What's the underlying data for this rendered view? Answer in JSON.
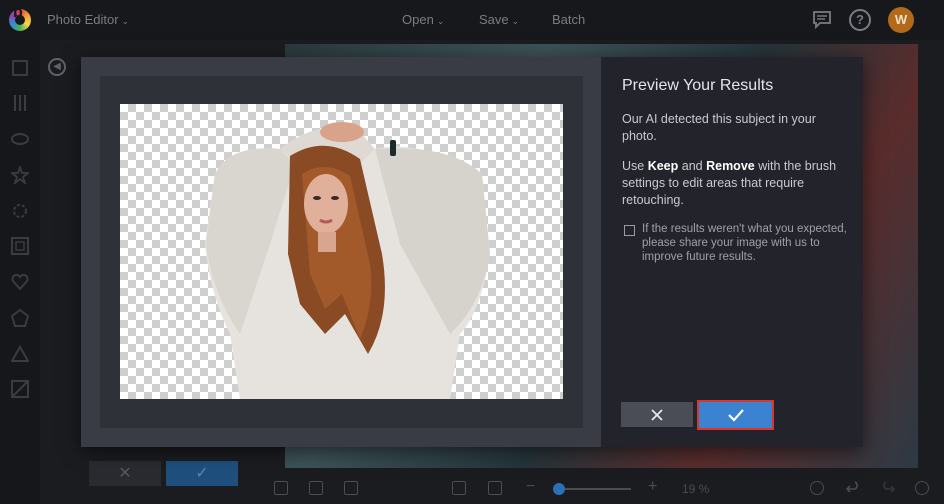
{
  "topbar": {
    "logo_letter": "b",
    "app_title": "Photo Editor",
    "menu": {
      "open": "Open",
      "save": "Save",
      "batch": "Batch"
    },
    "help_glyph": "?",
    "avatar_initial": "W"
  },
  "sidebar": {
    "icons": [
      "crop-icon",
      "adjust-icon",
      "eye-icon",
      "star-icon",
      "effects-icon",
      "frame-icon",
      "heart-icon",
      "shape-icon",
      "triangle-icon",
      "texture-icon"
    ]
  },
  "bottombar": {
    "zoom_minus": "−",
    "zoom_plus": "+",
    "zoom_value": "19 %",
    "zoom_fraction": 0.05
  },
  "modal": {
    "title": "Preview Your Results",
    "paragraph1": "Our AI detected this subject in your photo.",
    "paragraph2_parts": {
      "use": "Use ",
      "keep": "Keep",
      "and": " and ",
      "remove": "Remove",
      "rest": " with the brush settings to edit areas that require retouching."
    },
    "feedback_label": "If the results weren't what you expected, please share your image with us to improve future results.",
    "feedback_checked": false
  },
  "colors": {
    "accent": "#3b83d1",
    "highlight_border": "#d9362f",
    "panel_bg": "#23242b",
    "modal_bg": "#393b45"
  }
}
